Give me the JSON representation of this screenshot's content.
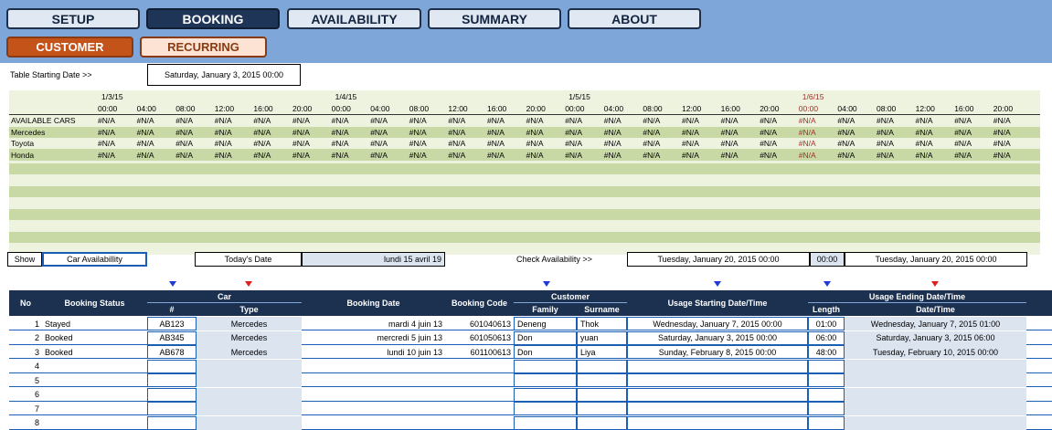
{
  "nav": {
    "tabs": [
      "SETUP",
      "BOOKING",
      "AVAILABILITY",
      "SUMMARY",
      "ABOUT"
    ],
    "subtabs": [
      "CUSTOMER",
      "RECURRING"
    ]
  },
  "availability": {
    "start_label": "Table Starting Date >>",
    "start_value": "Saturday, January 3, 2015 00:00",
    "dates": [
      "1/3/15",
      "1/4/15",
      "1/5/15",
      "1/6/15"
    ],
    "times": [
      "00:00",
      "04:00",
      "08:00",
      "12:00",
      "16:00",
      "20:00",
      "00:00",
      "04:00",
      "08:00",
      "12:00",
      "16:00",
      "20:00",
      "00:00",
      "04:00",
      "08:00",
      "12:00",
      "16:00",
      "20:00",
      "00:00",
      "04:00",
      "08:00",
      "12:00",
      "16:00",
      "20:00"
    ],
    "rows": [
      "AVAILABLE CARS",
      "Mercedes",
      "Toyota",
      "Honda"
    ],
    "cell_value": "#N/A",
    "highlight_color": "#a0302a"
  },
  "controls": {
    "show_label": "Show",
    "show_value": "Car Availabillity",
    "today_label": "Today's Date",
    "today_value": "lundi 15 avril 19",
    "check_label": "Check Availability >>",
    "check_start": "Tuesday, January 20, 2015 00:00",
    "check_length": "00:00",
    "check_end": "Tuesday, January 20, 2015 00:00"
  },
  "table": {
    "headers": {
      "no": "No",
      "status": "Booking Status",
      "car": "Car",
      "car_num": "#",
      "car_type": "Type",
      "booking_date": "Booking Date",
      "booking_code": "Booking Code",
      "customer": "Customer",
      "family": "Family",
      "surname": "Surname",
      "usage_start": "Usage Starting Date/Time",
      "length": "Length",
      "usage_end": "Usage Ending Date/Time",
      "usage_end_sub": "Date/Time"
    },
    "rows": [
      {
        "no": "1",
        "status": "Stayed",
        "num": "AB123",
        "type": "Mercedes",
        "date": "mardi 4 juin 13",
        "code": "601040613",
        "family": "Deneng",
        "surname": "Thok",
        "start": "Wednesday, January 7, 2015 00:00",
        "length": "01:00",
        "end": "Wednesday, January 7, 2015 01:00"
      },
      {
        "no": "2",
        "status": "Booked",
        "num": "AB345",
        "type": "Mercedes",
        "date": "mercredi 5 juin 13",
        "code": "601050613",
        "family": "Don",
        "surname": "yuan",
        "start": "Saturday, January 3, 2015 00:00",
        "length": "06:00",
        "end": "Saturday, January 3, 2015 06:00"
      },
      {
        "no": "3",
        "status": "Booked",
        "num": "AB678",
        "type": "Mercedes",
        "date": "lundi 10 juin 13",
        "code": "601100613",
        "family": "Don",
        "surname": "Liya",
        "start": "Sunday, February 8, 2015 00:00",
        "length": "48:00",
        "end": "Tuesday, February 10, 2015 00:00"
      },
      {
        "no": "4",
        "status": "",
        "num": "",
        "type": "",
        "date": "",
        "code": "",
        "family": "",
        "surname": "",
        "start": "",
        "length": "",
        "end": ""
      },
      {
        "no": "5",
        "status": "",
        "num": "",
        "type": "",
        "date": "",
        "code": "",
        "family": "",
        "surname": "",
        "start": "",
        "length": "",
        "end": ""
      },
      {
        "no": "6",
        "status": "",
        "num": "",
        "type": "",
        "date": "",
        "code": "",
        "family": "",
        "surname": "",
        "start": "",
        "length": "",
        "end": ""
      },
      {
        "no": "7",
        "status": "",
        "num": "",
        "type": "",
        "date": "",
        "code": "",
        "family": "",
        "surname": "",
        "start": "",
        "length": "",
        "end": ""
      },
      {
        "no": "8",
        "status": "",
        "num": "",
        "type": "",
        "date": "",
        "code": "",
        "family": "",
        "surname": "",
        "start": "",
        "length": "",
        "end": ""
      }
    ]
  }
}
